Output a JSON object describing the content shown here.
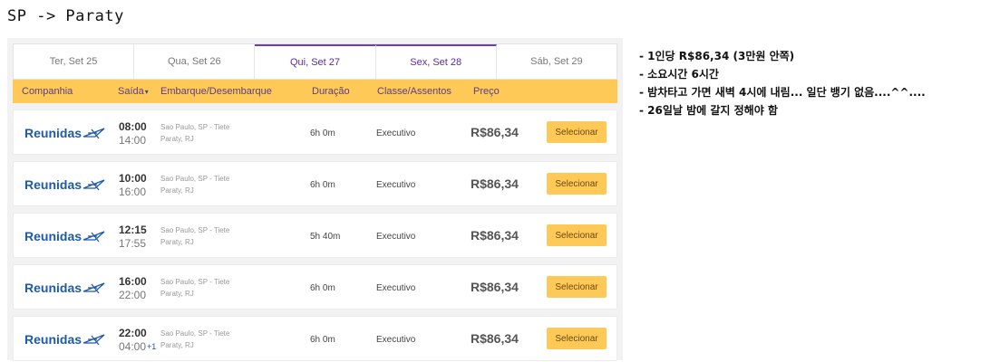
{
  "page_title": "SP -> Paraty",
  "date_tabs": [
    {
      "label": "Ter, Set 25"
    },
    {
      "label": "Qua, Set 26"
    },
    {
      "label": "Qui, Set 27"
    },
    {
      "label": "Sex, Set 28"
    },
    {
      "label": "Sáb, Set 29"
    }
  ],
  "active_tab": "Qui, Set 27",
  "columns": {
    "company": "Companhia",
    "departure": "Saída",
    "route": "Embarque/Desembarque",
    "duration": "Duração",
    "class": "Classe/Assentos",
    "price": "Preço"
  },
  "trips": [
    {
      "company": "Reunidas",
      "departure": "08:00",
      "arrival": "14:00",
      "next_day": "",
      "origin": "Sao Paulo, SP - Tiete",
      "destination": "Paraty, RJ",
      "duration": "6h 0m",
      "class": "Executivo",
      "price": "R$86,34",
      "button": "Selecionar"
    },
    {
      "company": "Reunidas",
      "departure": "10:00",
      "arrival": "16:00",
      "next_day": "",
      "origin": "Sao Paulo, SP - Tiete",
      "destination": "Paraty, RJ",
      "duration": "6h 0m",
      "class": "Executivo",
      "price": "R$86,34",
      "button": "Selecionar"
    },
    {
      "company": "Reunidas",
      "departure": "12:15",
      "arrival": "17:55",
      "next_day": "",
      "origin": "Sao Paulo, SP - Tiete",
      "destination": "Paraty, RJ",
      "duration": "5h 40m",
      "class": "Executivo",
      "price": "R$86,34",
      "button": "Selecionar"
    },
    {
      "company": "Reunidas",
      "departure": "16:00",
      "arrival": "22:00",
      "next_day": "",
      "origin": "Sao Paulo, SP - Tiete",
      "destination": "Paraty, RJ",
      "duration": "6h 0m",
      "class": "Executivo",
      "price": "R$86,34",
      "button": "Selecionar"
    },
    {
      "company": "Reunidas",
      "departure": "22:00",
      "arrival": "04:00",
      "next_day": "+1",
      "origin": "Sao Paulo, SP - Tiete",
      "destination": "Paraty, RJ",
      "duration": "6h 0m",
      "class": "Executivo",
      "price": "R$86,34",
      "button": "Selecionar"
    }
  ],
  "notes": [
    "- 1인당 R$86,34 (3만원 안쪽)",
    "- 소요시간 6시간",
    "- 밤차타고 가면 새벽 4시에 내림... 일단 뱅기 없음....^^....",
    "- 26일날 밤에 갈지 정해야 함"
  ],
  "colors": {
    "accent": "#ffc957",
    "brand": "#1f5aa8",
    "tab_active": "#6b3fb0"
  }
}
